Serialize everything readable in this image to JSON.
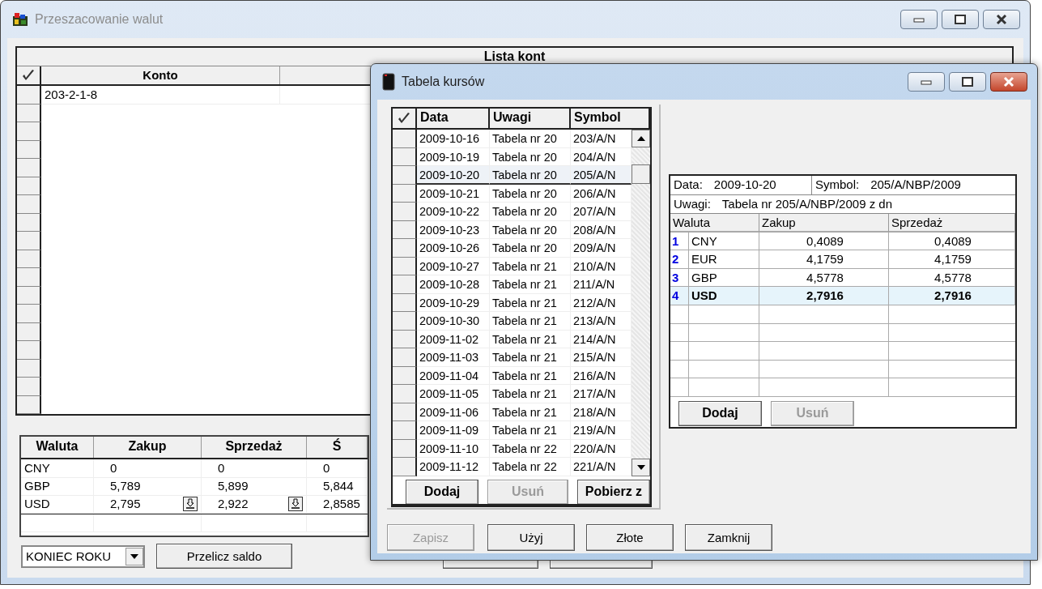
{
  "main_window": {
    "title": "Przeszacowanie walut",
    "active": false,
    "accounts_grid": {
      "title": "Lista kont",
      "columns": [
        "Konto"
      ],
      "rows": [
        {
          "account": "203-2-1-8"
        }
      ]
    },
    "rates_grid": {
      "columns": [
        "Waluta",
        "Zakup",
        "Sprzedaż",
        "Ś"
      ],
      "rows": [
        {
          "cells": [
            "CNY",
            "0",
            "0",
            "0"
          ],
          "has_picker": false
        },
        {
          "cells": [
            "GBP",
            "5,789",
            "5,899",
            "5,844"
          ],
          "has_picker": false
        },
        {
          "cells": [
            "USD",
            "2,795",
            "2,922",
            "2,8585"
          ],
          "has_picker": true
        }
      ]
    },
    "period_select": {
      "value": "KONIEC ROKU"
    },
    "buttons": [
      {
        "label": "Przelicz saldo",
        "disabled": false
      }
    ]
  },
  "dialog": {
    "title": "Tabela kursów",
    "active": true,
    "rates_list": {
      "columns": [
        "Data",
        "Uwagi",
        "Symbol"
      ],
      "rows": [
        {
          "date": "2009-10-16",
          "notes": "Tabela nr 20",
          "symbol": "203/A/N",
          "selected": false
        },
        {
          "date": "2009-10-19",
          "notes": "Tabela nr 20",
          "symbol": "204/A/N",
          "selected": false
        },
        {
          "date": "2009-10-20",
          "notes": "Tabela nr 20",
          "symbol": "205/A/N",
          "selected": true
        },
        {
          "date": "2009-10-21",
          "notes": "Tabela nr 20",
          "symbol": "206/A/N",
          "selected": false
        },
        {
          "date": "2009-10-22",
          "notes": "Tabela nr 20",
          "symbol": "207/A/N",
          "selected": false
        },
        {
          "date": "2009-10-23",
          "notes": "Tabela nr 20",
          "symbol": "208/A/N",
          "selected": false
        },
        {
          "date": "2009-10-26",
          "notes": "Tabela nr 20",
          "symbol": "209/A/N",
          "selected": false
        },
        {
          "date": "2009-10-27",
          "notes": "Tabela nr 21",
          "symbol": "210/A/N",
          "selected": false
        },
        {
          "date": "2009-10-28",
          "notes": "Tabela nr 21",
          "symbol": "211/A/N",
          "selected": false
        },
        {
          "date": "2009-10-29",
          "notes": "Tabela nr 21",
          "symbol": "212/A/N",
          "selected": false
        },
        {
          "date": "2009-10-30",
          "notes": "Tabela nr 21",
          "symbol": "213/A/N",
          "selected": false
        },
        {
          "date": "2009-11-02",
          "notes": "Tabela nr 21",
          "symbol": "214/A/N",
          "selected": false
        },
        {
          "date": "2009-11-03",
          "notes": "Tabela nr 21",
          "symbol": "215/A/N",
          "selected": false
        },
        {
          "date": "2009-11-04",
          "notes": "Tabela nr 21",
          "symbol": "216/A/N",
          "selected": false
        },
        {
          "date": "2009-11-05",
          "notes": "Tabela nr 21",
          "symbol": "217/A/N",
          "selected": false
        },
        {
          "date": "2009-11-06",
          "notes": "Tabela nr 21",
          "symbol": "218/A/N",
          "selected": false
        },
        {
          "date": "2009-11-09",
          "notes": "Tabela nr 21",
          "symbol": "219/A/N",
          "selected": false
        },
        {
          "date": "2009-11-10",
          "notes": "Tabela nr 22",
          "symbol": "220/A/N",
          "selected": false
        },
        {
          "date": "2009-11-12",
          "notes": "Tabela nr 22",
          "symbol": "221/A/N",
          "selected": false
        }
      ],
      "buttons": [
        {
          "label": "Dodaj",
          "disabled": false
        },
        {
          "label": "Usuń",
          "disabled": true
        },
        {
          "label": "Pobierz z",
          "disabled": false
        }
      ]
    },
    "detail": {
      "date_label": "Data:",
      "date": "2009-10-20",
      "symbol_label": "Symbol:",
      "symbol": "205/A/NBP/2009",
      "notes_label": "Uwagi:",
      "notes": "Tabela nr 205/A/NBP/2009 z dn",
      "columns": [
        "Waluta",
        "Zakup",
        "Sprzedaż"
      ],
      "rows": [
        {
          "number": "1",
          "currency": "CNY",
          "buy": "0,4089",
          "sell": "0,4089",
          "selected": false
        },
        {
          "number": "2",
          "currency": "EUR",
          "buy": "4,1759",
          "sell": "4,1759",
          "selected": false
        },
        {
          "number": "3",
          "currency": "GBP",
          "buy": "4,5778",
          "sell": "4,5778",
          "selected": false
        },
        {
          "number": "4",
          "currency": "USD",
          "buy": "2,7916",
          "sell": "2,7916",
          "selected": true
        }
      ],
      "buttons": [
        {
          "label": "Dodaj",
          "disabled": false
        },
        {
          "label": "Usuń",
          "disabled": true
        }
      ]
    },
    "buttons": [
      {
        "label": "Zapisz",
        "disabled": true
      },
      {
        "label": "Użyj",
        "disabled": false
      },
      {
        "label": "Złote",
        "disabled": false
      },
      {
        "label": "Zamknij",
        "disabled": false
      }
    ]
  }
}
